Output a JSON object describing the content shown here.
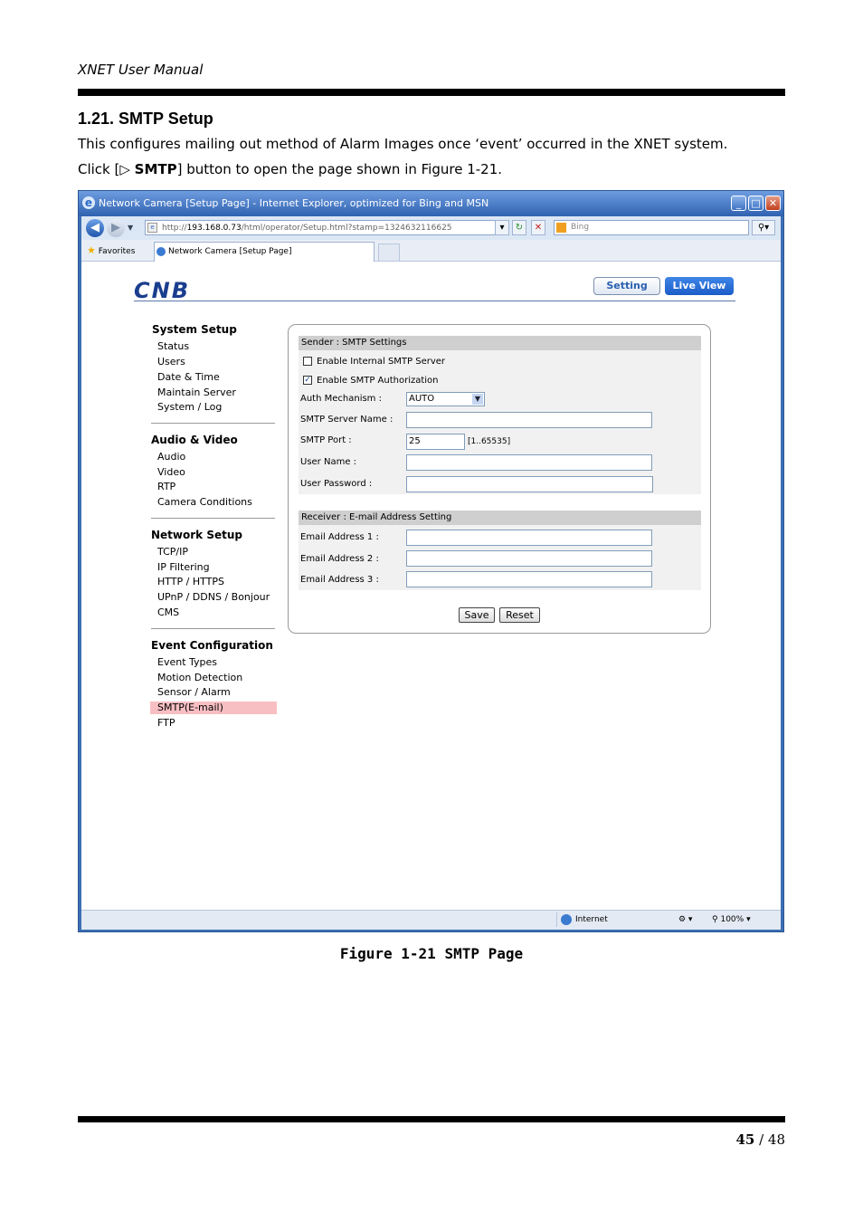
{
  "doc": {
    "header": "XNET User Manual",
    "section_title": "1.21. SMTP Setup",
    "para1": "This configures mailing out method of Alarm Images once ‘event’ occurred in the XNET system.",
    "para2_prefix": "Click [▷ ",
    "para2_bold": "SMTP",
    "para2_suffix": "] button to open the page shown in Figure 1-21.",
    "caption": "Figure 1-21 SMTP Page",
    "page_current": "45",
    "page_sep": " / ",
    "page_total": "48"
  },
  "browser": {
    "title": "Network Camera [Setup Page] - Internet Explorer, optimized for Bing and MSN",
    "url_prefix": "http://",
    "url_host": "193.168.0.73",
    "url_path": "/html/operator/Setup.html?stamp=1324632116625",
    "search_placeholder": "Bing",
    "favorites_label": "Favorites",
    "tab_label": "Network Camera [Setup Page]",
    "status_zone": "Internet",
    "zoom": "100%"
  },
  "app": {
    "logo": "CNB",
    "setting_label": "Setting",
    "live_view_label": "Live View",
    "menu": {
      "system_setup": "System Setup",
      "status": "Status",
      "users": "Users",
      "date_time": "Date & Time",
      "maintain_server": "Maintain Server",
      "system_log": "System / Log",
      "audio_video": "Audio & Video",
      "audio": "Audio",
      "video": "Video",
      "rtp": "RTP",
      "camera_conditions": "Camera Conditions",
      "network_setup": "Network Setup",
      "tcpip": "TCP/IP",
      "ip_filtering": "IP Filtering",
      "http_https": "HTTP / HTTPS",
      "upnp": "UPnP / DDNS / Bonjour",
      "cms": "CMS",
      "event_configuration": "Event Configuration",
      "event_types": "Event Types",
      "motion_detection": "Motion Detection",
      "sensor_alarm": "Sensor / Alarm",
      "smtp_email": "SMTP(E-mail)",
      "ftp": "FTP"
    },
    "sender": {
      "header": "Sender : SMTP Settings",
      "enable_internal": "Enable Internal SMTP Server",
      "enable_internal_checked": false,
      "enable_auth": "Enable SMTP Authorization",
      "enable_auth_checked": true,
      "auth_mechanism_label": "Auth Mechanism :",
      "auth_mechanism_value": "AUTO",
      "server_name_label": "SMTP Server Name :",
      "server_name_value": "",
      "port_label": "SMTP Port :",
      "port_value": "25",
      "port_range": "[1..65535]",
      "user_name_label": "User Name :",
      "user_name_value": "",
      "user_password_label": "User Password :",
      "user_password_value": ""
    },
    "receiver": {
      "header": "Receiver : E-mail Address Setting",
      "email1_label": "Email Address 1 :",
      "email1_value": "",
      "email2_label": "Email Address 2 :",
      "email2_value": "",
      "email3_label": "Email Address 3 :",
      "email3_value": ""
    },
    "save_label": "Save",
    "reset_label": "Reset"
  }
}
